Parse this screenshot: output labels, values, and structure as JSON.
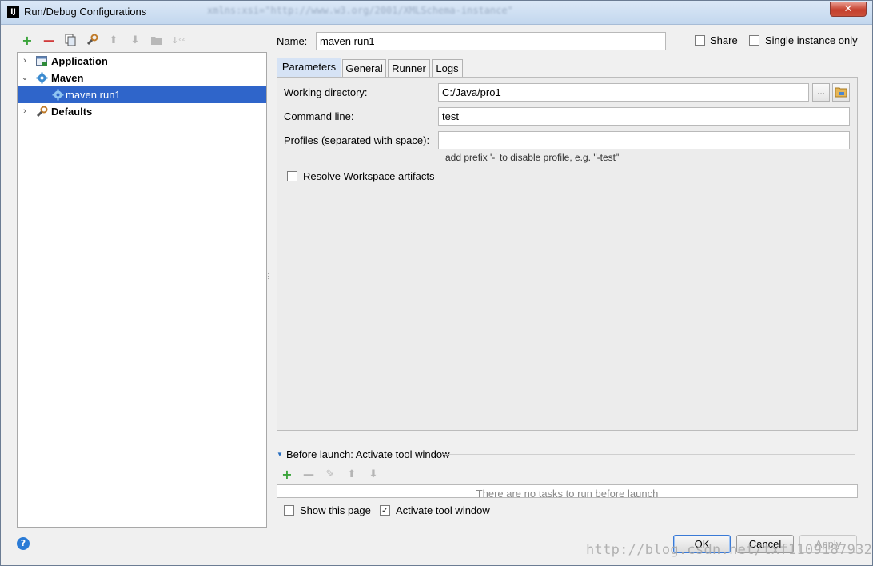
{
  "window": {
    "title": "Run/Debug Configurations",
    "title_bar_background_text": "xmlns:xsi=\"http://www.w3.org/2001/XMLSchema-instance\"",
    "app_icon_label": "IJ",
    "close_glyph": "✕"
  },
  "toolbar": {
    "icons": [
      "add-icon",
      "remove-icon",
      "copy-icon",
      "edit-defaults-icon",
      "move-up-icon",
      "move-down-icon",
      "folder-icon",
      "sort-icon"
    ],
    "add_glyph": "+",
    "remove_glyph": "—",
    "up_glyph": "⬆",
    "down_glyph": "⬇",
    "sort_glyph": "↓ᵃᶻ"
  },
  "tree": {
    "items": [
      {
        "label": "Application",
        "expanded": false,
        "level": 0,
        "bold": true
      },
      {
        "label": "Maven",
        "expanded": true,
        "level": 0,
        "bold": true
      },
      {
        "label": "maven run1",
        "level": 1,
        "selected": true
      },
      {
        "label": "Defaults",
        "expanded": false,
        "level": 0,
        "bold": true
      }
    ],
    "collapsed_glyph": "›",
    "expanded_glyph": "⌄"
  },
  "header": {
    "name_label": "Name:",
    "name_value": "maven run1",
    "share_label": "Share",
    "share_checked": false,
    "single_instance_label": "Single instance only",
    "single_instance_checked": false
  },
  "tabs": [
    {
      "label": "Parameters",
      "active": true
    },
    {
      "label": "General",
      "active": false
    },
    {
      "label": "Runner",
      "active": false
    },
    {
      "label": "Logs",
      "active": false
    }
  ],
  "parameters": {
    "working_directory_label": "Working directory:",
    "working_directory_value": "C:/Java/pro1",
    "browse_label": "...",
    "command_line_label": "Command line:",
    "command_line_value": "test",
    "profiles_label": "Profiles (separated with space):",
    "profiles_value": "",
    "profiles_hint": "add prefix '-' to disable profile, e.g. \"-test\"",
    "resolve_workspace_label": "Resolve Workspace artifacts",
    "resolve_workspace_checked": false
  },
  "before_launch": {
    "title": "Before launch: Activate tool window",
    "expand_glyph": "▼",
    "toolbar_icons": [
      "add-icon",
      "remove-icon",
      "edit-icon",
      "move-up-icon",
      "move-down-icon"
    ],
    "empty_text": "There are no tasks to run before launch",
    "show_page_label": "Show this page",
    "show_page_checked": false,
    "activate_tool_window_label": "Activate tool window",
    "activate_tool_window_checked": true,
    "check_glyph": "✓",
    "edit_glyph": "✎"
  },
  "buttons": {
    "help_glyph": "?",
    "ok": "OK",
    "cancel": "Cancel",
    "apply": "Apply"
  },
  "watermark": "http://blog.csdn.net/txf1109187932",
  "colors": {
    "selection": "#2f65ca",
    "add_green": "#3aa43a",
    "remove_red": "#d13b3b",
    "tab_active": "#d6e3f5",
    "close_red": "#c5402d"
  }
}
